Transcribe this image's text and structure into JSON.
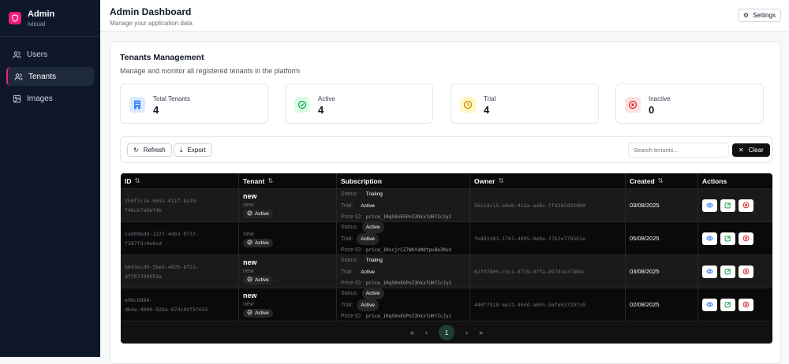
{
  "sidebar": {
    "brand": "Admin",
    "sub": "ivisual",
    "items": [
      {
        "label": "Users",
        "icon": "users-icon"
      },
      {
        "label": "Tenants",
        "icon": "users-icon",
        "active": true
      },
      {
        "label": "Images",
        "icon": "image-icon"
      }
    ]
  },
  "header": {
    "title": "Admin Dashboard",
    "subtitle": "Manage your application data",
    "settings": "Settings"
  },
  "section": {
    "title": "Tenants Management",
    "subtitle": "Manage and monitor all registered tenants in the platform"
  },
  "stats": [
    {
      "label": "Total Tenants",
      "value": "4",
      "color": "#3b82f6"
    },
    {
      "label": "Active",
      "value": "4",
      "color": "#16a34a"
    },
    {
      "label": "Trial",
      "value": "4",
      "color": "#ca8a04"
    },
    {
      "label": "Inactive",
      "value": "0",
      "color": "#dc2626"
    }
  ],
  "toolbar": {
    "refresh": "Refresh",
    "export": "Export",
    "search_placeholder": "Search tenants...",
    "clear": "Clear"
  },
  "table": {
    "headers": [
      "ID",
      "Tenant",
      "Subscription",
      "Owner",
      "Created",
      "Actions"
    ],
    "labels": {
      "status": "Status:",
      "trial": "Trial:",
      "price": "Price ID:"
    },
    "rows": [
      {
        "id1": "250f7c1e-60a1-411f-ba70-",
        "id2": "f48cb7e6bf4b",
        "name": "new",
        "sub": "new",
        "state": "Active",
        "status": "Trialing",
        "trial": "Active",
        "price": "price_1RqS0nEGPoI3hkxlUH7IcJy1",
        "owner": "56c14c15-e0ab-412a-aa8c-ffd202d920b9",
        "created": "03/08/2025"
      },
      {
        "id1": "cad09bdd-1227-4d63-9737-",
        "id2": "f387f3c0e6cd",
        "name": "",
        "sub": "new",
        "state": "Active",
        "status": "Active",
        "trial": "Active",
        "price": "price_1RscjrCZ7WhYaMdtpuBa3RuV",
        "owner": "fe883393-1701-4095-9e8e-1762e7785b1e",
        "created": "05/08/2025"
      },
      {
        "id1": "b643ecd0-5be5-4025-bf21-",
        "id2": "dff87394953a",
        "name": "new",
        "sub": "new",
        "state": "Active",
        "status": "Trialing",
        "trial": "Active",
        "price": "price_1RqS0nEGPoI3hkxlUH7IcJy1",
        "owner": "62f97805-c3c1-4719-97fa-d97d1e37894c",
        "created": "03/08/2025"
      },
      {
        "id1": "e98cb884-",
        "id2": "db4e-4009-928a-67dc89f5f655",
        "name": "new",
        "sub": "new",
        "state": "Active",
        "status": "Active",
        "trial": "Active",
        "price": "price_1RqS0nEGPoI3hkxlUH7IcJy1",
        "owner": "440f7918-6e21-40dd-a695-56fe03729fc0",
        "created": "02/08/2025"
      }
    ]
  },
  "pagination": {
    "first": "«",
    "prev": "‹",
    "current": "1",
    "next": "›",
    "last": "»"
  }
}
